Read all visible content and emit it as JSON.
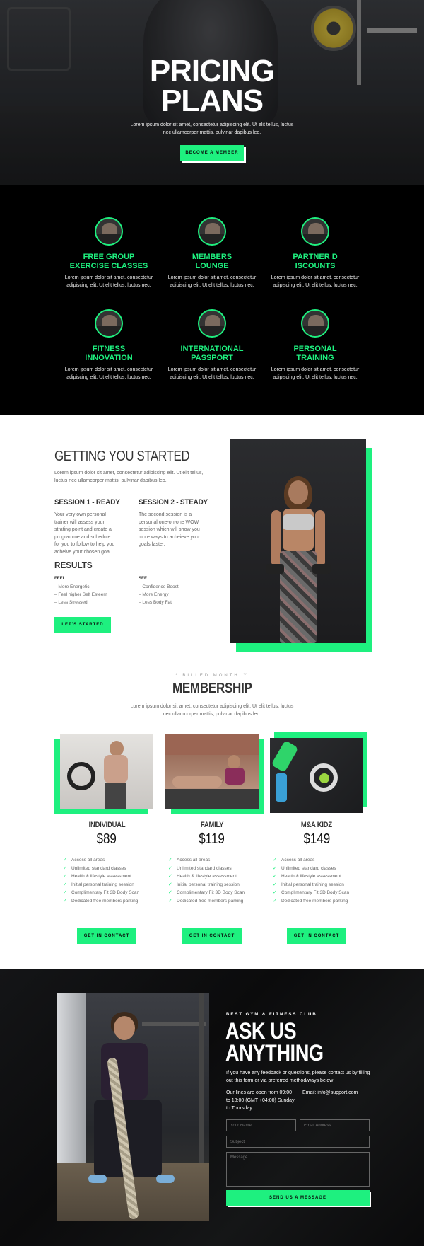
{
  "hero": {
    "title_line1": "PRICING",
    "title_line2": "PLANS",
    "text": "Lorem ipsum dolor sit amet, consectetur adipiscing elit. Ut elit tellus, luctus nec ullamcorper mattis, pulvinar dapibus leo.",
    "button": "BECOME A MEMBER"
  },
  "features": [
    {
      "title_line1": "FREE GROUP",
      "title_line2": "EXERCISE CLASSES",
      "text": "Lorem ipsum dolor sit amet, consectetur adipiscing elit. Ut elit tellus, luctus nec."
    },
    {
      "title_line1": "MEMBERS",
      "title_line2": "LOUNGE",
      "text": "Lorem ipsum dolor sit amet, consectetur adipiscing elit. Ut elit tellus, luctus nec."
    },
    {
      "title_line1": "PARTNER D",
      "title_line2": "ISCOUNTS",
      "text": "Lorem ipsum dolor sit amet, consectetur adipiscing elit. Ut elit tellus, luctus nec."
    },
    {
      "title_line1": "FITNESS",
      "title_line2": "INNOVATION",
      "text": "Lorem ipsum dolor sit amet, consectetur adipiscing elit. Ut elit tellus, luctus nec."
    },
    {
      "title_line1": "INTERNATIONAL",
      "title_line2": "PASSPORT",
      "text": "Lorem ipsum dolor sit amet, consectetur adipiscing elit. Ut elit tellus, luctus nec."
    },
    {
      "title_line1": "PERSONAL",
      "title_line2": "TRAINING",
      "text": "Lorem ipsum dolor sit amet, consectetur adipiscing elit. Ut elit tellus, luctus nec."
    }
  ],
  "getting_started": {
    "title": "GETTING YOU STARTED",
    "intro": "Lorem ipsum dolor sit amet, consectetur adipiscing elit. Ut elit tellus, luctus nec ullamcorper mattis, pulvinar dapibus leo.",
    "session1_title": "SESSION 1 - READY",
    "session1_text": "Your very own personal trainer will assess your strating point and create a programme and schedule for you to follow to help you acheive your chosen goal.",
    "session2_title": "SESSION 2 - STEADY",
    "session2_text": "The second session is a personal one-on-one WOW session which will show you more ways to acheieve your goals faster.",
    "results_title": "RESULTS",
    "feel_label": "FEEL",
    "feel_items": [
      "– More Energetic",
      "– Feel higher Self Esteem",
      "– Less Stressed"
    ],
    "see_label": "SEE",
    "see_items": [
      "– Confidence Boost",
      "– More Energy",
      "– Less Body Fat"
    ],
    "button": "LET'S STARTED"
  },
  "membership": {
    "kicker": "* BILLED MONTHLY",
    "title": "MEMBERSHIP",
    "intro": "Lorem ipsum dolor sit amet, consectetur adipiscing elit. Ut elit tellus, luctus nec ullamcorper mattis, pulvinar dapibus leo.",
    "plans": [
      {
        "name": "INDIVIDUAL",
        "price": "$89",
        "button": "GET IN CONTACT",
        "features": [
          "Access all areas",
          "Unlimited standard classes",
          "Health & lifestyle assessment",
          "Initial personal training session",
          "Complimentary Fit 3D Body Scan",
          "Dedicated free members parking"
        ]
      },
      {
        "name": "FAMILY",
        "price": "$119",
        "button": "GET IN CONTACT",
        "features": [
          "Access all areas",
          "Unlimited standard classes",
          "Health & lifestyle assessment",
          "Initial personal training session",
          "Complimentary Fit 3D Body Scan",
          "Dedicated free members parking"
        ]
      },
      {
        "name": "M&A KIDZ",
        "price": "$149",
        "button": "GET IN CONTACT",
        "features": [
          "Access all areas",
          "Unlimited standard classes",
          "Health & lifestyle assessment",
          "Initial personal training session",
          "Complimentary Fit 3D Body Scan",
          "Dedicated free members parking"
        ]
      }
    ]
  },
  "contact": {
    "kicker": "BEST GYM & FITNESS CLUB",
    "title_line1": "ASK US",
    "title_line2": "ANYTHING",
    "intro": "If you have any feedback or questions, please contact us by filling out this form or via preferred method/ways below:",
    "hours": "Our lines are open from 09:00 to 18:00 (GMT +04:00) Sunday to Thursday",
    "email": "Email: info@support.com",
    "name_placeholder": "Your Name",
    "email_placeholder": "Email Address",
    "subject_placeholder": "Subject",
    "message_placeholder": "Message",
    "button": "SEND US A MESSAGE"
  },
  "colors": {
    "accent": "#1ef07f",
    "dark": "#000000"
  }
}
